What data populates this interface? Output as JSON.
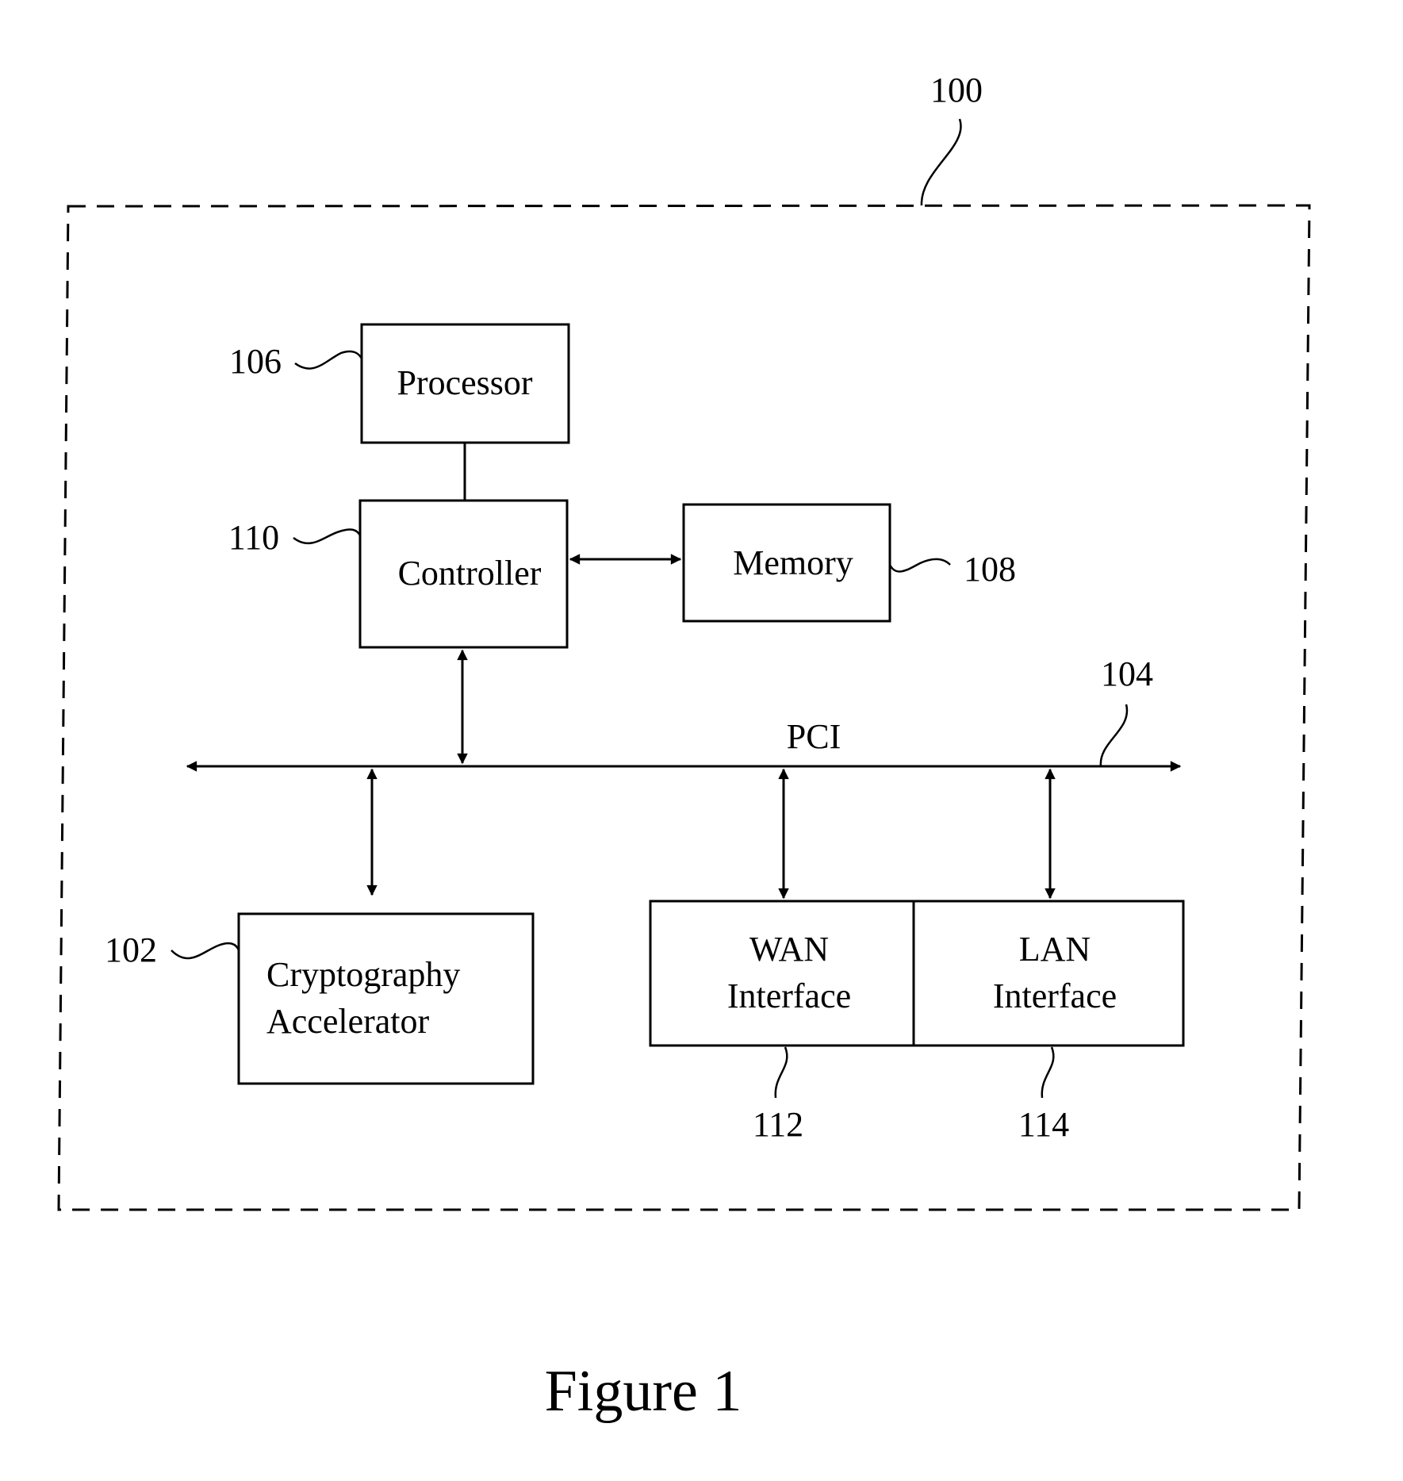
{
  "figure": {
    "caption": "Figure 1",
    "system_ref": "100",
    "colors": {
      "ink": "#000000",
      "background": "#ffffff"
    }
  },
  "blocks": {
    "processor": {
      "label": "Processor",
      "ref": "106"
    },
    "controller": {
      "label": "Controller",
      "ref": "110"
    },
    "memory": {
      "label": "Memory",
      "ref": "108"
    },
    "crypto": {
      "label_line1": "Cryptography",
      "label_line2": "Accelerator",
      "ref": "102"
    },
    "wan": {
      "label_line1": "WAN",
      "label_line2": "Interface",
      "ref": "112"
    },
    "lan": {
      "label_line1": "LAN",
      "label_line2": "Interface",
      "ref": "114"
    }
  },
  "bus": {
    "label": "PCI",
    "ref": "104"
  },
  "connections": [
    {
      "from": "Processor",
      "to": "Controller",
      "type": "line"
    },
    {
      "from": "Controller",
      "to": "Memory",
      "type": "bidirectional-arrow"
    },
    {
      "from": "Controller",
      "to": "PCI",
      "type": "bidirectional-arrow"
    },
    {
      "from": "PCI",
      "to": "Cryptography Accelerator",
      "type": "bidirectional-arrow"
    },
    {
      "from": "PCI",
      "to": "WAN Interface",
      "type": "bidirectional-arrow"
    },
    {
      "from": "PCI",
      "to": "LAN Interface",
      "type": "bidirectional-arrow"
    }
  ]
}
